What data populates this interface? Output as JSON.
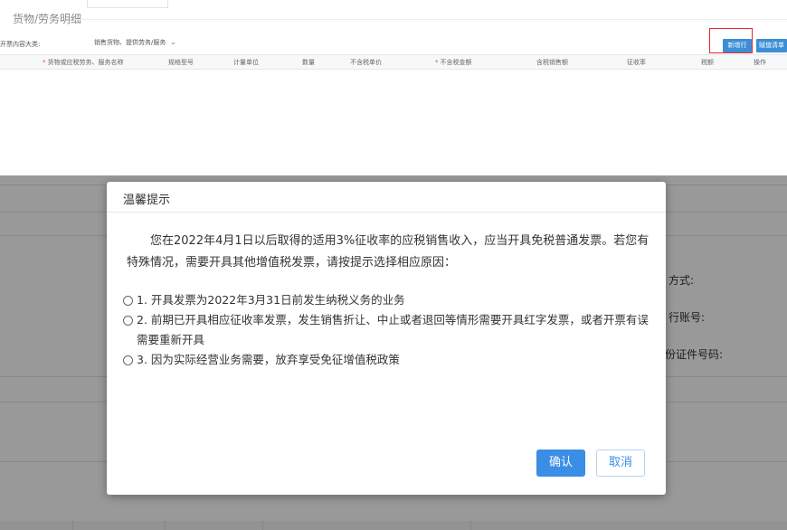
{
  "top": {
    "section_title": "货物/劳务明细",
    "kind_label": "开票内容大类:",
    "kind_value": "销售货物、提供劳务/服务",
    "new_row_button": "新增行",
    "inventory_button": "赋值清单"
  },
  "table": {
    "required_mark": "*",
    "columns": {
      "name": "货物或应税劳务、服务名称",
      "spec": "规格型号",
      "unit": "计量单位",
      "qty": "数量",
      "price": "不含税单价",
      "amount": "不含税金额",
      "tax_incl": "含税销售额",
      "rate": "征收率",
      "tax": "税额",
      "op": "操作"
    }
  },
  "background": {
    "label_method": "方式:",
    "label_account": "行账号:",
    "label_id": "份证件号码:"
  },
  "dialog": {
    "title": "温馨提示",
    "message": "您在2022年4月1日以后取得的适用3%征收率的应税销售收入，应当开具免税普通发票。若您有特殊情况，需要开具其他增值税发票，请按提示选择相应原因：",
    "options": [
      "1. 开具发票为2022年3月31日前发生纳税义务的业务",
      "2. 前期已开具相应征收率发票，发生销售折让、中止或者退回等情形需要开具红字发票，或者开票有误需要重新开具",
      "3. 因为实际经营业务需要，放弃享受免征增值税政策"
    ],
    "confirm": "确认",
    "cancel": "取消"
  },
  "colors": {
    "primary": "#3a8ee6",
    "highlight": "#e22a2a"
  }
}
